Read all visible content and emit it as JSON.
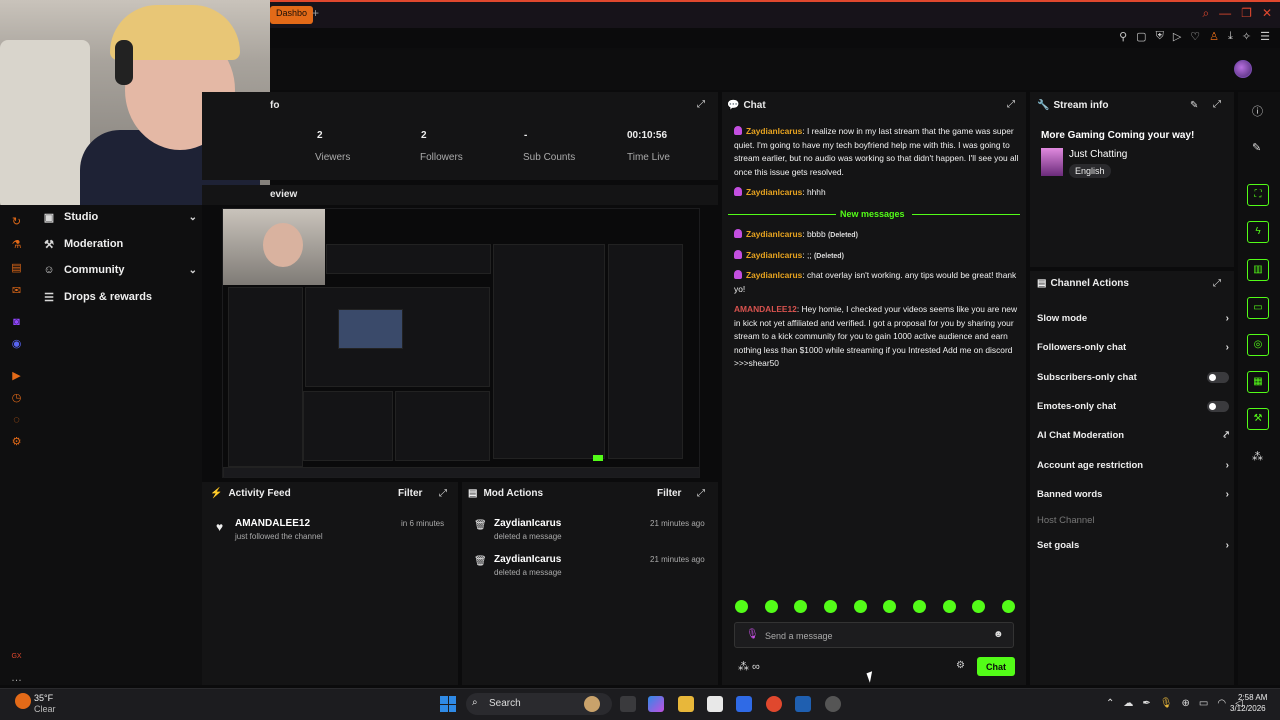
{
  "browser": {
    "tab_label": "Dashbo",
    "new_tab": "+"
  },
  "stats": {
    "title_fragment": "fo",
    "viewers": "2",
    "viewers_label": "Viewers",
    "followers": "2",
    "followers_label": "Followers",
    "subs": "-",
    "subs_label": "Sub Counts",
    "time_live": "00:10:56",
    "time_live_label": "Time Live"
  },
  "preview": {
    "title_fragment": "eview"
  },
  "nav": {
    "items": [
      {
        "label": "Studio",
        "icon": "studio-icon",
        "chevron": true
      },
      {
        "label": "Moderation",
        "icon": "gavel-icon",
        "chevron": false
      },
      {
        "label": "Community",
        "icon": "community-icon",
        "chevron": true
      },
      {
        "label": "Drops & rewards",
        "icon": "gift-icon",
        "chevron": false
      }
    ]
  },
  "activity": {
    "title": "Activity Feed",
    "filter": "Filter",
    "items": [
      {
        "name": "AMANDALEE12",
        "action": "just followed the channel",
        "time": "in 6 minutes"
      }
    ]
  },
  "mod_actions": {
    "title": "Mod Actions",
    "filter": "Filter",
    "items": [
      {
        "name": "ZaydianIcarus",
        "action": "deleted a message",
        "time": "21 minutes ago"
      },
      {
        "name": "ZaydianIcarus",
        "action": "deleted a message",
        "time": "21 minutes ago"
      }
    ]
  },
  "chat": {
    "title": "Chat",
    "messages": [
      {
        "user": "ZaydianIcarus",
        "text": "I realize now in my last stream that the game was super quiet. I'm going to have my tech boyfriend help me with this. I was going to stream earlier, but no audio was working so that didn't happen. I'll see you all once this issue gets resolved.",
        "deleted": ""
      },
      {
        "user": "ZaydianIcarus",
        "text": "hhhh",
        "deleted": ""
      },
      {
        "user": "ZaydianIcarus",
        "text": "bbbb",
        "deleted": "(Deleted)"
      },
      {
        "user": "ZaydianIcarus",
        "text": ";;",
        "deleted": "(Deleted)"
      },
      {
        "user": "ZaydianIcarus",
        "text": "chat overlay isn't working. any tips would be great! thank yo!",
        "deleted": ""
      },
      {
        "user": "AMANDALEE12",
        "text": "Hey homie, I checked your videos seems like you are new in kick not yet affiliated and verified. I got a proposal for you by sharing your stream to a kick community for you to gain 1000 active audience and earn nothing less than $1000 while streaming if you Intrested Add me on discord >>>shear50",
        "deleted": ""
      }
    ],
    "new_messages": "New messages",
    "input_placeholder": "Send a message",
    "send_label": "Chat",
    "colors": {
      "accent": "#53fc18",
      "username": "#e7a320",
      "username_alt": "#d9534f"
    }
  },
  "stream_info": {
    "title": "Stream info",
    "stream_title": "More Gaming Coming your way!",
    "category": "Just Chatting",
    "language": "English"
  },
  "channel_actions": {
    "title": "Channel Actions",
    "rows": [
      {
        "label": "Slow mode",
        "control": "chevron"
      },
      {
        "label": "Followers-only chat",
        "control": "chevron"
      },
      {
        "label": "Subscribers-only chat",
        "control": "toggle"
      },
      {
        "label": "Emotes-only chat",
        "control": "toggle"
      },
      {
        "label": "AI Chat Moderation",
        "control": "external"
      },
      {
        "label": "Account age restriction",
        "control": "chevron"
      },
      {
        "label": "Banned words",
        "control": "chevron"
      },
      {
        "label": "Host Channel",
        "control": "none"
      },
      {
        "label": "Set goals",
        "control": "chevron"
      }
    ]
  },
  "taskbar": {
    "temperature": "35°F",
    "weather": "Clear",
    "search": "Search",
    "time": "2:58 AM",
    "date": "3/12/2026"
  }
}
